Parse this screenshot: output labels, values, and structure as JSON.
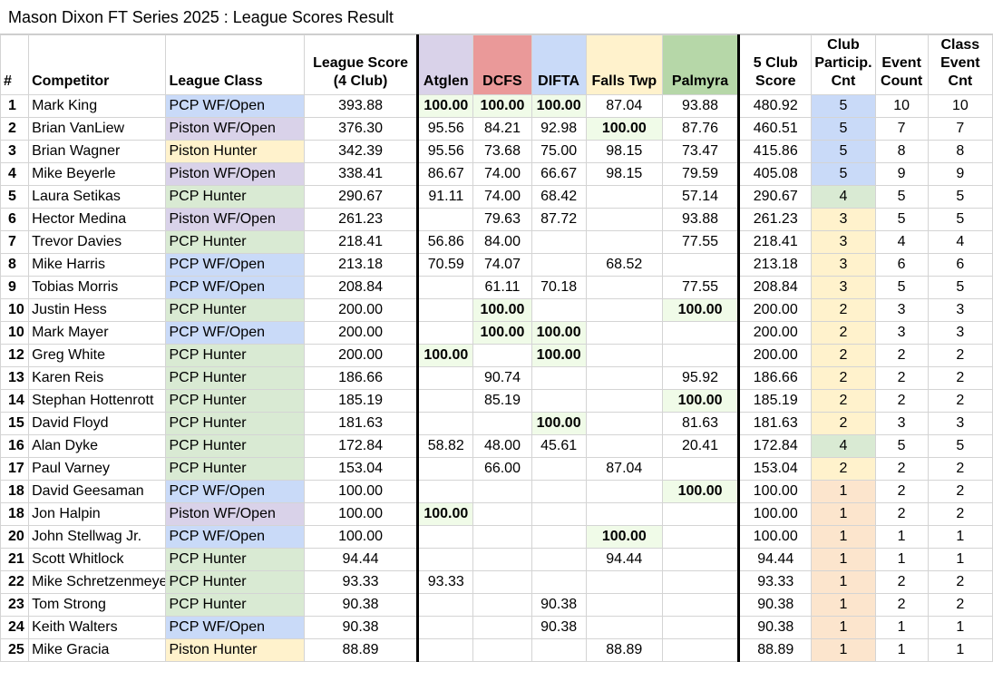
{
  "title": "Mason Dixon FT Series 2025 : League Scores Result",
  "colors": {
    "class_pcp_wf_open": "#c9daf8",
    "class_piston_wf_open": "#d9d2e9",
    "class_piston_hunter": "#fff2cc",
    "class_pcp_hunter": "#d9ead3",
    "hdr_atglen": "#d9d2e9",
    "hdr_dcfs": "#ea9999",
    "hdr_difta": "#c9daf8",
    "hdr_falls": "#fff2cc",
    "hdr_palmyra": "#b6d7a8",
    "club5": "#c9daf8",
    "club4": "#d9ead3",
    "club3": "#fff2cc",
    "club2": "#fff2cc",
    "club1": "#fce5cd",
    "max_score_highlight": "#f0fbe8"
  },
  "headers": {
    "rank": "#",
    "competitor": "Competitor",
    "league_class": "League Class",
    "league_score": "League Score (4 Club)",
    "atglen": "Atglen",
    "dcfs": "DCFS",
    "difta": "DIFTA",
    "falls": "Falls Twp",
    "palmyra": "Palmyra",
    "club5_score": "5 Club Score",
    "club_particip": "Club Particip. Cnt",
    "event_count": "Event Count",
    "class_event": "Class Event Cnt"
  },
  "rows": [
    {
      "rank": "1",
      "name": "Mark King",
      "cls": "PCP WF/Open",
      "league": "393.88",
      "atglen": "100.00",
      "dcfs": "100.00",
      "difta": "100.00",
      "falls": "87.04",
      "palmyra": "93.88",
      "score5": "480.92",
      "clubs": "5",
      "events": "10",
      "classev": "10"
    },
    {
      "rank": "2",
      "name": "Brian VanLiew",
      "cls": "Piston WF/Open",
      "league": "376.30",
      "atglen": "95.56",
      "dcfs": "84.21",
      "difta": "92.98",
      "falls": "100.00",
      "palmyra": "87.76",
      "score5": "460.51",
      "clubs": "5",
      "events": "7",
      "classev": "7"
    },
    {
      "rank": "3",
      "name": "Brian Wagner",
      "cls": "Piston Hunter",
      "league": "342.39",
      "atglen": "95.56",
      "dcfs": "73.68",
      "difta": "75.00",
      "falls": "98.15",
      "palmyra": "73.47",
      "score5": "415.86",
      "clubs": "5",
      "events": "8",
      "classev": "8"
    },
    {
      "rank": "4",
      "name": "Mike Beyerle",
      "cls": "Piston WF/Open",
      "league": "338.41",
      "atglen": "86.67",
      "dcfs": "74.00",
      "difta": "66.67",
      "falls": "98.15",
      "palmyra": "79.59",
      "score5": "405.08",
      "clubs": "5",
      "events": "9",
      "classev": "9"
    },
    {
      "rank": "5",
      "name": "Laura Setikas",
      "cls": "PCP Hunter",
      "league": "290.67",
      "atglen": "91.11",
      "dcfs": "74.00",
      "difta": "68.42",
      "falls": "",
      "palmyra": "57.14",
      "score5": "290.67",
      "clubs": "4",
      "events": "5",
      "classev": "5"
    },
    {
      "rank": "6",
      "name": "Hector Medina",
      "cls": "Piston WF/Open",
      "league": "261.23",
      "atglen": "",
      "dcfs": "79.63",
      "difta": "87.72",
      "falls": "",
      "palmyra": "93.88",
      "score5": "261.23",
      "clubs": "3",
      "events": "5",
      "classev": "5"
    },
    {
      "rank": "7",
      "name": "Trevor Davies",
      "cls": "PCP Hunter",
      "league": "218.41",
      "atglen": "56.86",
      "dcfs": "84.00",
      "difta": "",
      "falls": "",
      "palmyra": "77.55",
      "score5": "218.41",
      "clubs": "3",
      "events": "4",
      "classev": "4"
    },
    {
      "rank": "8",
      "name": "Mike Harris",
      "cls": "PCP WF/Open",
      "league": "213.18",
      "atglen": "70.59",
      "dcfs": "74.07",
      "difta": "",
      "falls": "68.52",
      "palmyra": "",
      "score5": "213.18",
      "clubs": "3",
      "events": "6",
      "classev": "6"
    },
    {
      "rank": "9",
      "name": "Tobias Morris",
      "cls": "PCP WF/Open",
      "league": "208.84",
      "atglen": "",
      "dcfs": "61.11",
      "difta": "70.18",
      "falls": "",
      "palmyra": "77.55",
      "score5": "208.84",
      "clubs": "3",
      "events": "5",
      "classev": "5"
    },
    {
      "rank": "10",
      "name": "Justin Hess",
      "cls": "PCP Hunter",
      "league": "200.00",
      "atglen": "",
      "dcfs": "100.00",
      "difta": "",
      "falls": "",
      "palmyra": "100.00",
      "score5": "200.00",
      "clubs": "2",
      "events": "3",
      "classev": "3"
    },
    {
      "rank": "10",
      "name": "Mark Mayer",
      "cls": "PCP WF/Open",
      "league": "200.00",
      "atglen": "",
      "dcfs": "100.00",
      "difta": "100.00",
      "falls": "",
      "palmyra": "",
      "score5": "200.00",
      "clubs": "2",
      "events": "3",
      "classev": "3"
    },
    {
      "rank": "12",
      "name": "Greg White",
      "cls": "PCP Hunter",
      "league": "200.00",
      "atglen": "100.00",
      "dcfs": "",
      "difta": "100.00",
      "falls": "",
      "palmyra": "",
      "score5": "200.00",
      "clubs": "2",
      "events": "2",
      "classev": "2"
    },
    {
      "rank": "13",
      "name": "Karen Reis",
      "cls": "PCP Hunter",
      "league": "186.66",
      "atglen": "",
      "dcfs": "90.74",
      "difta": "",
      "falls": "",
      "palmyra": "95.92",
      "score5": "186.66",
      "clubs": "2",
      "events": "2",
      "classev": "2"
    },
    {
      "rank": "14",
      "name": "Stephan Hottenrott",
      "cls": "PCP Hunter",
      "league": "185.19",
      "atglen": "",
      "dcfs": "85.19",
      "difta": "",
      "falls": "",
      "palmyra": "100.00",
      "score5": "185.19",
      "clubs": "2",
      "events": "2",
      "classev": "2"
    },
    {
      "rank": "15",
      "name": "David Floyd",
      "cls": "PCP Hunter",
      "league": "181.63",
      "atglen": "",
      "dcfs": "",
      "difta": "100.00",
      "falls": "",
      "palmyra": "81.63",
      "score5": "181.63",
      "clubs": "2",
      "events": "3",
      "classev": "3"
    },
    {
      "rank": "16",
      "name": "Alan Dyke",
      "cls": "PCP Hunter",
      "league": "172.84",
      "atglen": "58.82",
      "dcfs": "48.00",
      "difta": "45.61",
      "falls": "",
      "palmyra": "20.41",
      "score5": "172.84",
      "clubs": "4",
      "events": "5",
      "classev": "5"
    },
    {
      "rank": "17",
      "name": "Paul Varney",
      "cls": "PCP Hunter",
      "league": "153.04",
      "atglen": "",
      "dcfs": "66.00",
      "difta": "",
      "falls": "87.04",
      "palmyra": "",
      "score5": "153.04",
      "clubs": "2",
      "events": "2",
      "classev": "2"
    },
    {
      "rank": "18",
      "name": "David Geesaman",
      "cls": "PCP WF/Open",
      "league": "100.00",
      "atglen": "",
      "dcfs": "",
      "difta": "",
      "falls": "",
      "palmyra": "100.00",
      "score5": "100.00",
      "clubs": "1",
      "events": "2",
      "classev": "2"
    },
    {
      "rank": "18",
      "name": "Jon Halpin",
      "cls": "Piston WF/Open",
      "league": "100.00",
      "atglen": "100.00",
      "dcfs": "",
      "difta": "",
      "falls": "",
      "palmyra": "",
      "score5": "100.00",
      "clubs": "1",
      "events": "2",
      "classev": "2"
    },
    {
      "rank": "20",
      "name": "John Stellwag Jr.",
      "cls": "PCP WF/Open",
      "league": "100.00",
      "atglen": "",
      "dcfs": "",
      "difta": "",
      "falls": "100.00",
      "palmyra": "",
      "score5": "100.00",
      "clubs": "1",
      "events": "1",
      "classev": "1"
    },
    {
      "rank": "21",
      "name": "Scott Whitlock",
      "cls": "PCP Hunter",
      "league": "94.44",
      "atglen": "",
      "dcfs": "",
      "difta": "",
      "falls": "94.44",
      "palmyra": "",
      "score5": "94.44",
      "clubs": "1",
      "events": "1",
      "classev": "1"
    },
    {
      "rank": "22",
      "name": "Mike Schretzenmeyer",
      "cls": "PCP Hunter",
      "league": "93.33",
      "atglen": "93.33",
      "dcfs": "",
      "difta": "",
      "falls": "",
      "palmyra": "",
      "score5": "93.33",
      "clubs": "1",
      "events": "2",
      "classev": "2"
    },
    {
      "rank": "23",
      "name": "Tom Strong",
      "cls": "PCP Hunter",
      "league": "90.38",
      "atglen": "",
      "dcfs": "",
      "difta": "90.38",
      "falls": "",
      "palmyra": "",
      "score5": "90.38",
      "clubs": "1",
      "events": "2",
      "classev": "2"
    },
    {
      "rank": "24",
      "name": "Keith Walters",
      "cls": "PCP WF/Open",
      "league": "90.38",
      "atglen": "",
      "dcfs": "",
      "difta": "90.38",
      "falls": "",
      "palmyra": "",
      "score5": "90.38",
      "clubs": "1",
      "events": "1",
      "classev": "1"
    },
    {
      "rank": "25",
      "name": "Mike Gracia",
      "cls": "Piston Hunter",
      "league": "88.89",
      "atglen": "",
      "dcfs": "",
      "difta": "",
      "falls": "88.89",
      "palmyra": "",
      "score5": "88.89",
      "clubs": "1",
      "events": "1",
      "classev": "1"
    }
  ]
}
